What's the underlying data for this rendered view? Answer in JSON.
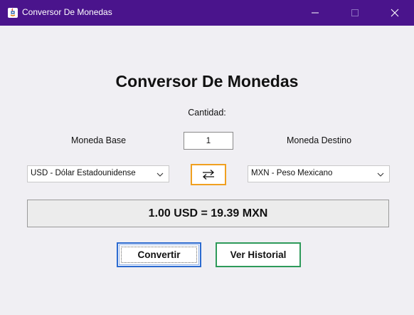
{
  "window": {
    "title": "Conversor De Monedas",
    "titlebar_color": "#4a148c"
  },
  "main": {
    "heading": "Conversor De Monedas",
    "amount_label": "Cantidad:",
    "amount_value": "1",
    "base_label": "Moneda Base",
    "target_label": "Moneda Destino",
    "base_currency": "USD - Dólar Estadounidense",
    "target_currency": "MXN - Peso Mexicano",
    "swap_icon": "swap-arrows-icon",
    "result": "1.00 USD = 19.39 MXN",
    "convert_button": "Convertir",
    "history_button": "Ver Historial"
  },
  "colors": {
    "swap_border": "#f0a020",
    "convert_border": "#2b6ad0",
    "history_border": "#2e9a5a"
  }
}
